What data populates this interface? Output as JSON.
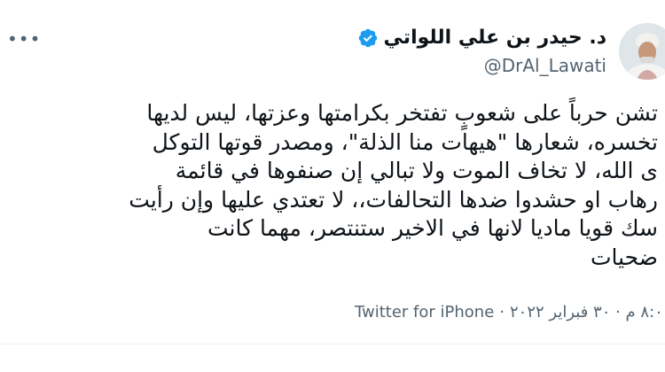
{
  "tweet": {
    "display_name": "د. حيدر بن علي اللواتي",
    "handle": "@DrAl_Lawati",
    "more_icon": "more-horizontal-icon",
    "verified_icon": "verified-badge-icon",
    "verified_color": "#1d9bf0",
    "body_lines": [
      "تشن حرباً على شعوبٍ تفتخر بكرامتها وعزتها، ليس لديها",
      "تخسره، شعارها \"هيهات منا الذلة\"، ومصدر قوتها التوكل",
      "ى الله، لا تخاف الموت ولا تبالي إن صنفوها في قائمة",
      "رهاب او حشدوا ضدها التحالفات،، لا تعتدي عليها وإن رأيت",
      "سك قويا ماديا لانها في الاخير ستنتصر، مهما كانت",
      "ضحيات"
    ],
    "source": "Twitter for iPhone",
    "separator": "·",
    "timestamp": "٨:٠ م · ٣٠ فبراير ٢٠٢٢"
  }
}
